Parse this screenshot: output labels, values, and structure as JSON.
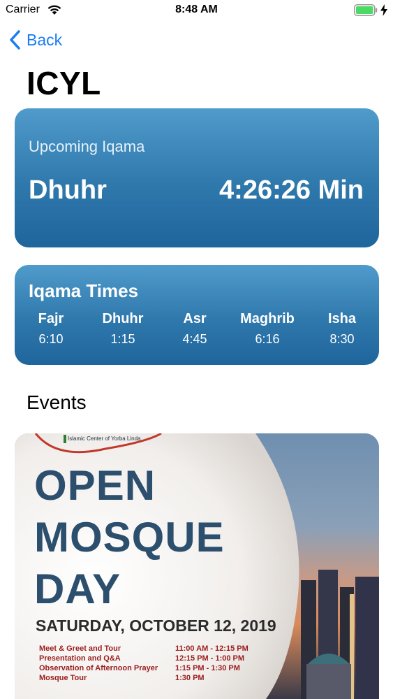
{
  "status_bar": {
    "carrier": "Carrier",
    "time": "8:48 AM"
  },
  "nav": {
    "back_label": "Back",
    "title": "ICYL"
  },
  "upcoming": {
    "label": "Upcoming Iqama",
    "prayer": "Dhuhr",
    "countdown": "4:26:26 Min"
  },
  "iqama_times": {
    "title": "Iqama Times",
    "prayers": [
      {
        "name": "Fajr",
        "time": "6:10"
      },
      {
        "name": "Dhuhr",
        "time": "1:15"
      },
      {
        "name": "Asr",
        "time": "4:45"
      },
      {
        "name": "Maghrib",
        "time": "6:16"
      },
      {
        "name": "Isha",
        "time": "8:30"
      }
    ]
  },
  "events": {
    "heading": "Events",
    "poster": {
      "org": "Islamic Center of Yorba Linda",
      "lines": [
        "OPEN",
        "MOSQUE",
        "DAY"
      ],
      "date": "SATURDAY, OCTOBER 12, 2019",
      "schedule": [
        {
          "event": "Meet & Greet and Tour",
          "time": "11:00 AM - 12:15 PM"
        },
        {
          "event": "Presentation and Q&A",
          "time": "12:15 PM - 1:00 PM"
        },
        {
          "event": "Observation of Afternoon Prayer",
          "time": "1:15 PM - 1:30 PM"
        },
        {
          "event": "Mosque Tour",
          "time": "1:30 PM"
        }
      ]
    }
  },
  "colors": {
    "accent": "#1a7cf5",
    "card_top": "#4f9bcb",
    "card_bottom": "#1e659c",
    "poster_title": "#2c4f6e",
    "schedule_text": "#9b1c1c",
    "battery": "#4cd964"
  }
}
